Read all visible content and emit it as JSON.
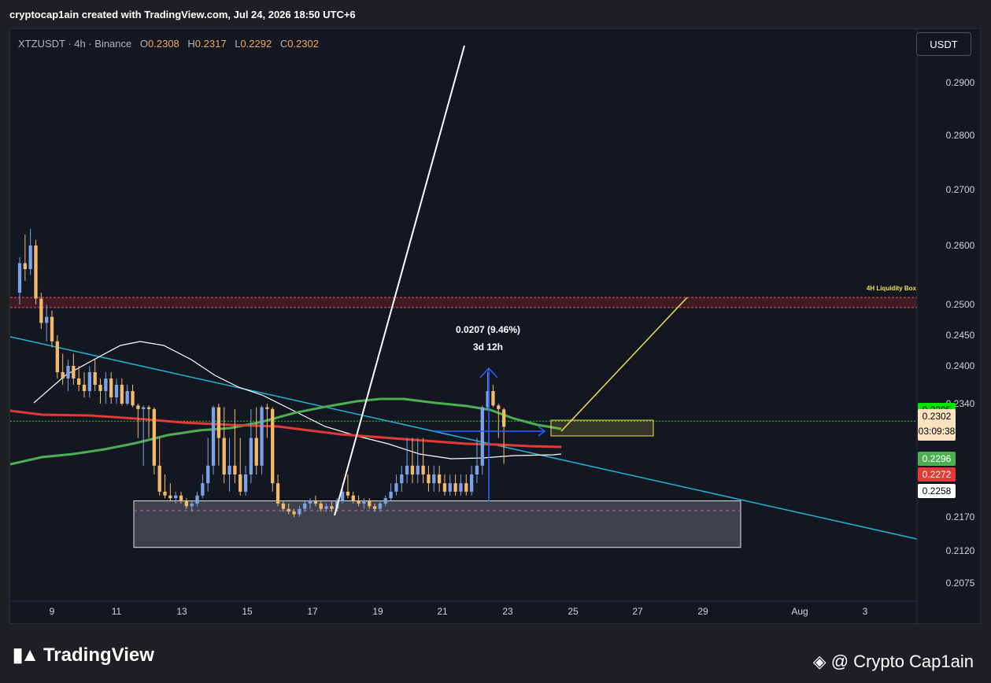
{
  "header": {
    "creator_text": "cryptocap1ain created with TradingView.com, Jul 24, 2026 18:50 UTC+6"
  },
  "chart_data": {
    "type": "candlestick",
    "symbol_line": "XTZUSDT · 4h · Binance",
    "ohlc": {
      "o_label": "O",
      "o": "0.2308",
      "h_label": "H",
      "h": "0.2317",
      "l_label": "L",
      "l": "0.2292",
      "c_label": "C",
      "c": "0.2302"
    },
    "currency_button": "USDT",
    "y_ticks": [
      "0.2900",
      "0.2800",
      "0.2700",
      "0.2600",
      "0.2500",
      "0.2450",
      "0.2400",
      "0.2340",
      "0.2170",
      "0.2120",
      "0.2075"
    ],
    "x_ticks": [
      "9",
      "11",
      "13",
      "15",
      "17",
      "19",
      "21",
      "23",
      "25",
      "27",
      "29",
      "Aug",
      "3"
    ],
    "price_labels": [
      {
        "value": "0.2305",
        "color": "#00e600",
        "text_color": "#000000"
      },
      {
        "value": "0.2302",
        "sub": "03:09:38",
        "color": "#fbe3c0",
        "text_color": "#000000"
      },
      {
        "value": "0.2296",
        "color": "#4caf50",
        "text_color": "#ffffff"
      },
      {
        "value": "0.2272",
        "color": "#e53935",
        "text_color": "#ffffff"
      },
      {
        "value": "0.2258",
        "color": "#ffffff",
        "text_color": "#000000"
      }
    ],
    "annotations": {
      "liquidity_box_label": "4H Liquidity Box",
      "measure_value": "0.0207 (9.46%)",
      "measure_time": "3d 12h"
    },
    "colors": {
      "up": "#7ba1e6",
      "down": "#f4b96b",
      "ma_white": "#ffffff",
      "ma_green": "#4caf50",
      "ma_red": "#e53935",
      "trendline": "#1fb5d6",
      "projection": "#f2e04c",
      "support_line": "#00e600",
      "liquidity_box": "#ef5350"
    },
    "candles_start_day": 8.0,
    "candles_step_days": 0.1667,
    "candles": [
      [
        0.252,
        0.258,
        0.25,
        0.257
      ],
      [
        0.257,
        0.262,
        0.254,
        0.256
      ],
      [
        0.256,
        0.263,
        0.255,
        0.26
      ],
      [
        0.26,
        0.261,
        0.25,
        0.251
      ],
      [
        0.251,
        0.252,
        0.246,
        0.247
      ],
      [
        0.247,
        0.25,
        0.244,
        0.248
      ],
      [
        0.248,
        0.249,
        0.243,
        0.244
      ],
      [
        0.244,
        0.245,
        0.238,
        0.239
      ],
      [
        0.239,
        0.242,
        0.237,
        0.238
      ],
      [
        0.238,
        0.241,
        0.236,
        0.24
      ],
      [
        0.24,
        0.242,
        0.237,
        0.238
      ],
      [
        0.238,
        0.24,
        0.236,
        0.237
      ],
      [
        0.237,
        0.239,
        0.235,
        0.236
      ],
      [
        0.236,
        0.24,
        0.235,
        0.239
      ],
      [
        0.239,
        0.241,
        0.236,
        0.237
      ],
      [
        0.237,
        0.238,
        0.234,
        0.236
      ],
      [
        0.236,
        0.239,
        0.234,
        0.238
      ],
      [
        0.238,
        0.239,
        0.234,
        0.235
      ],
      [
        0.235,
        0.238,
        0.234,
        0.237
      ],
      [
        0.237,
        0.238,
        0.233,
        0.234
      ],
      [
        0.234,
        0.237,
        0.233,
        0.236
      ],
      [
        0.236,
        0.237,
        0.232,
        0.233
      ],
      [
        0.233,
        0.234,
        0.23,
        0.231
      ],
      [
        0.231,
        0.233,
        0.229,
        0.232
      ],
      [
        0.232,
        0.233,
        0.23,
        0.231
      ],
      [
        0.231,
        0.232,
        0.228,
        0.229
      ],
      [
        0.229,
        0.23,
        0.225,
        0.226
      ],
      [
        0.226,
        0.228,
        0.224,
        0.225
      ],
      [
        0.225,
        0.227,
        0.223,
        0.224
      ],
      [
        0.224,
        0.226,
        0.222,
        0.225
      ],
      [
        0.225,
        0.226,
        0.222,
        0.223
      ],
      [
        0.223,
        0.224,
        0.22,
        0.221
      ],
      [
        0.221,
        0.223,
        0.219,
        0.222
      ],
      [
        0.222,
        0.226,
        0.221,
        0.225
      ],
      [
        0.225,
        0.228,
        0.224,
        0.227
      ],
      [
        0.227,
        0.23,
        0.226,
        0.229
      ],
      [
        0.229,
        0.233,
        0.228,
        0.232
      ],
      [
        0.232,
        0.234,
        0.229,
        0.23
      ],
      [
        0.23,
        0.232,
        0.227,
        0.228
      ],
      [
        0.228,
        0.23,
        0.226,
        0.229
      ],
      [
        0.229,
        0.231,
        0.227,
        0.228
      ],
      [
        0.228,
        0.23,
        0.225,
        0.226
      ],
      [
        0.226,
        0.229,
        0.225,
        0.228
      ],
      [
        0.228,
        0.231,
        0.227,
        0.23
      ],
      [
        0.23,
        0.232,
        0.228,
        0.229
      ],
      [
        0.229,
        0.233,
        0.228,
        0.232
      ],
      [
        0.232,
        0.234,
        0.23,
        0.231
      ],
      [
        0.231,
        0.232,
        0.226,
        0.227
      ],
      [
        0.227,
        0.228,
        0.221,
        0.222
      ],
      [
        0.222,
        0.223,
        0.219,
        0.22
      ],
      [
        0.22,
        0.222,
        0.218,
        0.219
      ],
      [
        0.219,
        0.22,
        0.217,
        0.218
      ],
      [
        0.218,
        0.221,
        0.217,
        0.22
      ],
      [
        0.22,
        0.223,
        0.219,
        0.222
      ],
      [
        0.222,
        0.224,
        0.22,
        0.223
      ],
      [
        0.223,
        0.225,
        0.221,
        0.222
      ],
      [
        0.222,
        0.223,
        0.219,
        0.22
      ],
      [
        0.22,
        0.222,
        0.219,
        0.221
      ],
      [
        0.221,
        0.223,
        0.219,
        0.22
      ],
      [
        0.22,
        0.224,
        0.219,
        0.223
      ],
      [
        0.223,
        0.227,
        0.222,
        0.226
      ],
      [
        0.226,
        0.228,
        0.224,
        0.225
      ],
      [
        0.225,
        0.226,
        0.222,
        0.223
      ],
      [
        0.223,
        0.225,
        0.221,
        0.222
      ],
      [
        0.222,
        0.224,
        0.22,
        0.223
      ],
      [
        0.223,
        0.224,
        0.22,
        0.221
      ],
      [
        0.221,
        0.222,
        0.219,
        0.22
      ],
      [
        0.22,
        0.223,
        0.219,
        0.222
      ],
      [
        0.222,
        0.225,
        0.221,
        0.224
      ],
      [
        0.224,
        0.227,
        0.223,
        0.226
      ],
      [
        0.226,
        0.228,
        0.225,
        0.227
      ],
      [
        0.227,
        0.229,
        0.226,
        0.228
      ],
      [
        0.228,
        0.23,
        0.227,
        0.229
      ],
      [
        0.229,
        0.23,
        0.227,
        0.228
      ],
      [
        0.228,
        0.23,
        0.227,
        0.229
      ],
      [
        0.229,
        0.23,
        0.227,
        0.228
      ],
      [
        0.228,
        0.229,
        0.226,
        0.227
      ],
      [
        0.227,
        0.229,
        0.226,
        0.228
      ],
      [
        0.228,
        0.229,
        0.226,
        0.227
      ],
      [
        0.227,
        0.228,
        0.225,
        0.226
      ],
      [
        0.226,
        0.228,
        0.225,
        0.227
      ],
      [
        0.227,
        0.228,
        0.225,
        0.226
      ],
      [
        0.226,
        0.228,
        0.225,
        0.227
      ],
      [
        0.227,
        0.228,
        0.225,
        0.226
      ],
      [
        0.226,
        0.229,
        0.225,
        0.228
      ],
      [
        0.228,
        0.23,
        0.227,
        0.229
      ],
      [
        0.229,
        0.233,
        0.228,
        0.232
      ],
      [
        0.232,
        0.239,
        0.231,
        0.236
      ],
      [
        0.236,
        0.237,
        0.232,
        0.233
      ],
      [
        0.233,
        0.234,
        0.23,
        0.231
      ],
      [
        0.2308,
        0.2317,
        0.2292,
        0.2302
      ]
    ]
  }
}
